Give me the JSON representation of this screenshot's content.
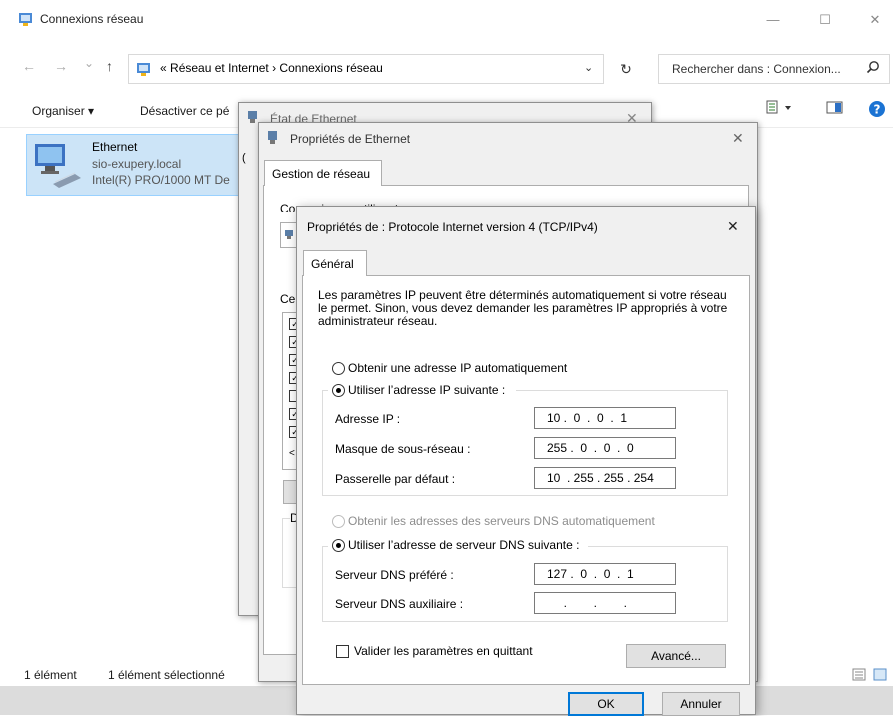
{
  "explorer": {
    "title": "Connexions réseau",
    "window_controls": {
      "minimize": "—",
      "maximize": "☐",
      "close": "✕"
    },
    "nav": {
      "back": "←",
      "forward": "→",
      "recent": "⌄",
      "up": "↑"
    },
    "address": {
      "prefix": "«",
      "path": "Réseau et Internet  ›  Connexions réseau",
      "dropdown": "⌄"
    },
    "refresh": "↻",
    "search": {
      "placeholder": "Rechercher dans : Connexion..."
    },
    "toolbar": {
      "organize": "Organiser ▾",
      "disable": "Désactiver ce pé"
    },
    "connection": {
      "name": "Ethernet",
      "domain": "sio-exupery.local",
      "adapter": "Intel(R) PRO/1000 MT De"
    },
    "status": {
      "count": "1 élément",
      "selected": "1 élément sélectionné"
    },
    "icons": [
      "network-folder-icon",
      "search-icon",
      "view-options-icon",
      "preview-pane-icon",
      "help-icon",
      "ethernet-adapter-icon"
    ]
  },
  "eth_status": {
    "title": "État de Ethernet"
  },
  "eth_props": {
    "title": "Propriétés de Ethernet",
    "tab": "Gestion de réseau",
    "connect_using_label": "Connexion en utilisant :",
    "components_label": "Ce",
    "description_label": "D"
  },
  "ipv4": {
    "title": "Propriétés de : Protocole Internet version 4 (TCP/IPv4)",
    "tab": "Général",
    "intro": "Les paramètres IP peuvent être déterminés automatiquement si votre réseau le permet. Sinon, vous devez demander les paramètres IP appropriés à votre administrateur réseau.",
    "ip_auto": "Obtenir une adresse IP automatiquement",
    "ip_manual": "Utiliser l’adresse IP suivante :",
    "ip_address_label": "Adresse IP :",
    "ip_address": "10 .  0  .  0  .  1",
    "subnet_label": "Masque de sous-réseau :",
    "subnet": "255 .  0  .  0  .  0",
    "gateway_label": "Passerelle par défaut :",
    "gateway": "10  . 255 . 255 . 254",
    "dns_auto": "Obtenir les adresses des serveurs DNS automatiquement",
    "dns_manual": "Utiliser l’adresse de serveur DNS suivante :",
    "dns_pref_label": "Serveur DNS préféré :",
    "dns_pref": "127 .  0  .  0  .  1",
    "dns_alt_label": "Serveur DNS auxiliaire :",
    "dns_alt": "     .        .        .",
    "validate_label": "Valider les paramètres en quittant",
    "advanced": "Avancé...",
    "ok": "OK",
    "cancel": "Annuler",
    "close": "✕"
  }
}
